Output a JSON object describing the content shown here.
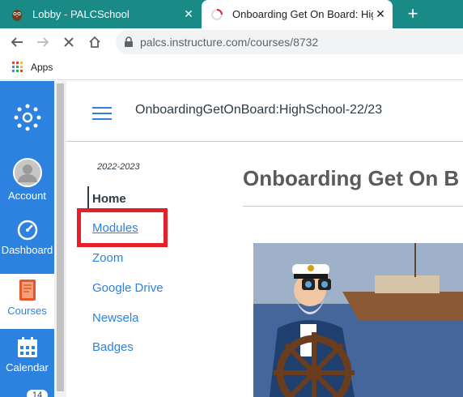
{
  "browser": {
    "tabs": [
      {
        "title": "Lobby - PALCSchool",
        "active": false
      },
      {
        "title": "Onboarding Get On Board: High",
        "active": true
      }
    ],
    "url": "palcs.instructure.com/courses/8732",
    "bookmarks_label": "Apps"
  },
  "global_nav": {
    "items": [
      {
        "label": "Account",
        "icon": "account-icon"
      },
      {
        "label": "Dashboard",
        "icon": "dashboard-icon"
      },
      {
        "label": "Courses",
        "icon": "courses-icon",
        "active": true
      },
      {
        "label": "Calendar",
        "icon": "calendar-icon"
      }
    ],
    "badge": "14"
  },
  "header": {
    "breadcrumb": "OnboardingGetOnBoard:HighSchool-22/23"
  },
  "course_nav": {
    "term": "2022-2023",
    "items": [
      {
        "label": "Home",
        "active": true
      },
      {
        "label": "Modules"
      },
      {
        "label": "Zoom"
      },
      {
        "label": "Google Drive"
      },
      {
        "label": "Newsela"
      },
      {
        "label": "Badges"
      }
    ]
  },
  "main": {
    "title": "Onboarding Get On B"
  },
  "colors": {
    "tabbar": "#1a8a87",
    "canvas_blue": "#2d82e0",
    "highlight": "#e6202a"
  }
}
